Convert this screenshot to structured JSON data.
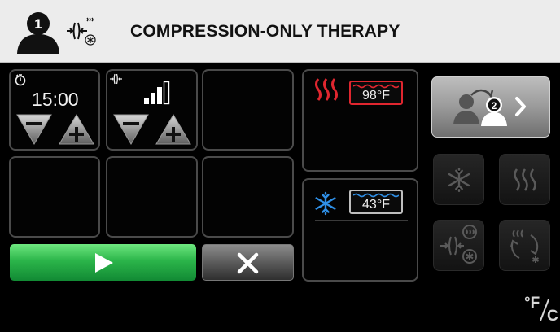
{
  "header": {
    "title": "COMPRESSION-ONLY THERAPY",
    "patient_number": "1",
    "mode_icon": "compression-only-icon"
  },
  "timer": {
    "value": "15:00",
    "icon": "timer-icon",
    "decrease_icon": "minus-icon",
    "increase_icon": "plus-icon"
  },
  "compression": {
    "icon": "compression-icon",
    "level_icon": "signal-bars-icon",
    "level": "3 of 4",
    "decrease_icon": "minus-icon",
    "increase_icon": "plus-icon"
  },
  "heat": {
    "icon": "heat-waves-icon",
    "temperature": "98°F",
    "color": "#e0262f"
  },
  "cold": {
    "icon": "snowflake-icon",
    "temperature": "43°F",
    "color": "#2f8fe6"
  },
  "actions": {
    "start_icon": "play-icon",
    "cancel_icon": "close-icon",
    "start_color": "#2bb54a"
  },
  "side_buttons": {
    "next_patient_number": "2",
    "next_patient_icon": "switch-patient-icon",
    "cold_icon": "snowflake-icon",
    "heat_icon": "heat-waves-icon",
    "compression_cold_icon": "compression-cold-icon",
    "contrast_icon": "contrast-therapy-icon"
  },
  "units": {
    "label_f": "°F",
    "label_c": "C"
  }
}
